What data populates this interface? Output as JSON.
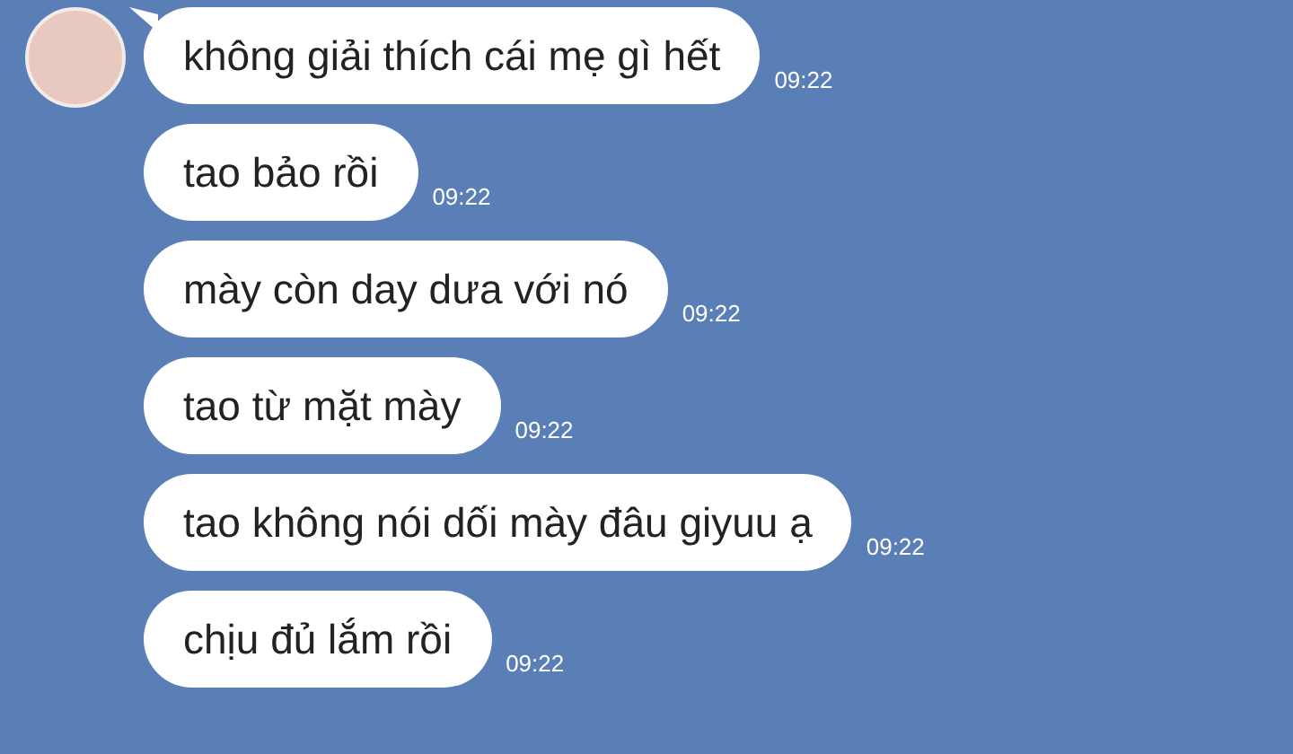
{
  "messages": [
    {
      "text": "không giải thích cái mẹ gì hết",
      "time": "09:22"
    },
    {
      "text": "tao bảo rồi",
      "time": "09:22"
    },
    {
      "text": "mày còn day dưa với nó",
      "time": "09:22"
    },
    {
      "text": "tao từ mặt mày",
      "time": "09:22"
    },
    {
      "text": "tao không nói dối mày đâu giyuu ạ",
      "time": "09:22"
    },
    {
      "text": "chịu đủ lắm rồi",
      "time": "09:22"
    }
  ]
}
